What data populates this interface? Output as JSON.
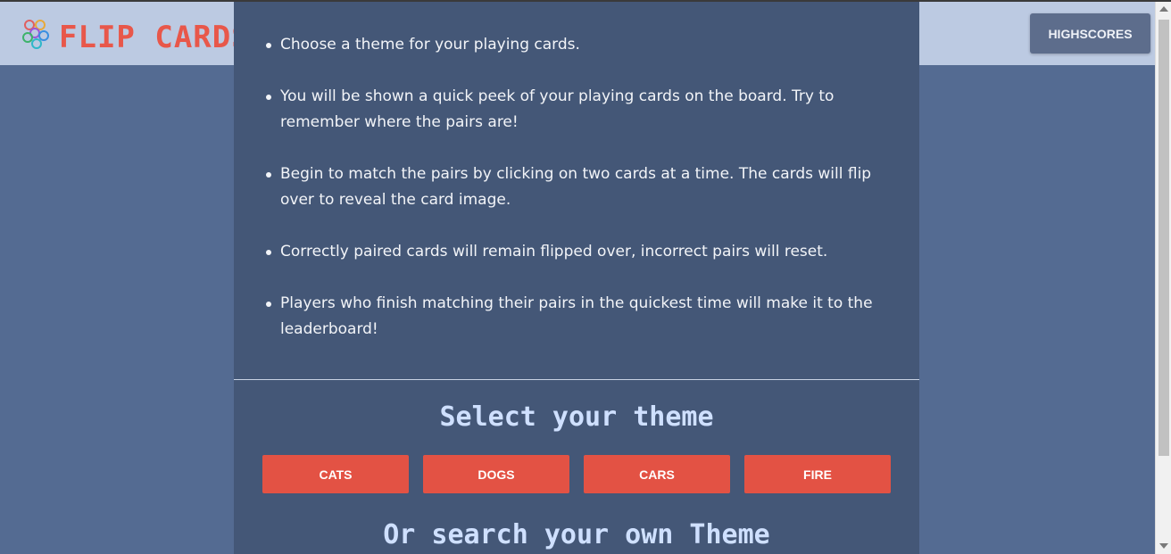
{
  "header": {
    "brand": "FLIP CARDS",
    "highscores_label": "HIGHSCORES"
  },
  "modal": {
    "rules": [
      "Choose a theme for your playing cards.",
      "You will be shown a quick peek of your playing cards on the board. Try to remember where the pairs are!",
      "Begin to match the pairs by clicking on two cards at a time. The cards will flip over to reveal the card image.",
      "Correctly paired cards will remain flipped over, incorrect pairs will reset.",
      "Players who finish matching their pairs in the quickest time will make it to the leaderboard!"
    ],
    "select_title": "Select your theme",
    "themes": [
      "CATS",
      "DOGS",
      "CARS",
      "FIRE"
    ],
    "search_title": "Or search your own Theme"
  },
  "colors": {
    "page_bg": "#546b92",
    "header_bg": "#bccae2",
    "modal_bg": "#445777",
    "accent": "#e35244",
    "title_text": "#cfe0ff"
  },
  "icons": {
    "logo": "circles-logo-icon",
    "scroll_up": "arrow-up-icon",
    "scroll_down": "arrow-down-icon"
  }
}
